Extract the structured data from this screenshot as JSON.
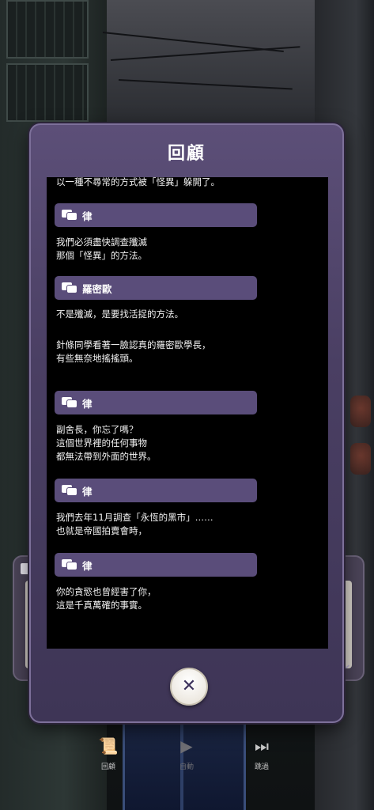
{
  "dialog": {
    "title": "回顧",
    "close_icon": "close-x-icon"
  },
  "log": {
    "entries": [
      {
        "type": "text",
        "text": "以一種不尋常的方式被「怪異」躲開了。"
      },
      {
        "type": "speaker",
        "name": "律"
      },
      {
        "type": "text",
        "text": "我們必須盡快調查殲滅"
      },
      {
        "type": "text",
        "text": "那個「怪異」的方法。"
      },
      {
        "type": "speaker",
        "name": "羅密歐"
      },
      {
        "type": "text",
        "text": "不是殲滅，是要找活捉的方法。"
      },
      {
        "type": "text",
        "text": "針條同學看著一臉認真的羅密歐學長，"
      },
      {
        "type": "text",
        "text": "有些無奈地搖搖頭。"
      },
      {
        "type": "speaker",
        "name": "律"
      },
      {
        "type": "text",
        "text": "副舍長，你忘了嗎？"
      },
      {
        "type": "text",
        "text": "這個世界裡的任何事物"
      },
      {
        "type": "text",
        "text": "都無法帶到外面的世界。"
      },
      {
        "type": "speaker",
        "name": "律"
      },
      {
        "type": "text",
        "text": "我們去年11月調查「永恆的黑市」……"
      },
      {
        "type": "text",
        "text": "也就是帝國拍賣會時，"
      },
      {
        "type": "speaker",
        "name": "律"
      },
      {
        "type": "text",
        "text": "你的貪慾也曾經害了你，"
      },
      {
        "type": "text",
        "text": "這是千真萬確的事實。"
      }
    ]
  },
  "toolbar": {
    "review_label": "回顧",
    "auto_label": "自動",
    "skip_label": "跳過",
    "review_icon": "scroll-icon",
    "auto_icon": "play-icon",
    "skip_icon": "skip-icon"
  },
  "colors": {
    "panel": "#4a3f63",
    "speaker_bar": "#5a4d7a",
    "log_bg": "#000000"
  }
}
